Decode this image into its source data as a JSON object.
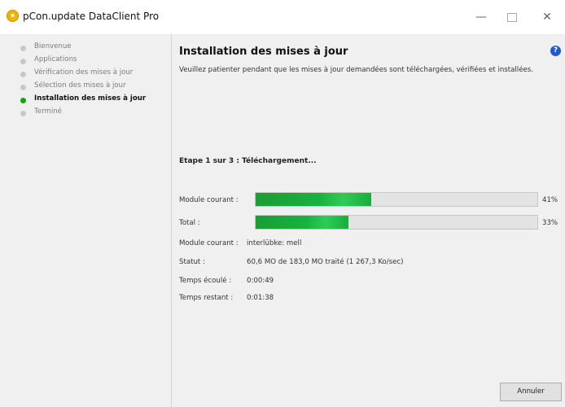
{
  "window": {
    "title": "pCon.update DataClient Pro",
    "minimize_label": "—",
    "close_label": "✕"
  },
  "sidebar": {
    "items": [
      {
        "label": "Bienvenue",
        "active": false
      },
      {
        "label": "Applications",
        "active": false
      },
      {
        "label": "Vérification des mises à jour",
        "active": false
      },
      {
        "label": "Sélection des mises à jour",
        "active": false
      },
      {
        "label": "Installation des mises à jour",
        "active": true
      },
      {
        "label": "Terminé",
        "active": false
      }
    ]
  },
  "main": {
    "title": "Installation des mises à jour",
    "help_label": "?",
    "subtitle": "Veuillez patienter pendant que les mises à jour demandées sont téléchargées, vérifiées et installées.",
    "step_heading": "Etape 1 sur 3 : Téléchargement...",
    "progress": {
      "current": {
        "label": "Module courant :",
        "percent": 41,
        "percent_label": "41%"
      },
      "total": {
        "label": "Total :",
        "percent": 33,
        "percent_label": "33%"
      }
    },
    "details": {
      "module": {
        "label": "Module courant :",
        "value": "interlübke: mell"
      },
      "status": {
        "label": "Statut :",
        "value": "60,6 MO de 183,0 MO traité (1 267,3 Ko/sec)"
      },
      "elapsed": {
        "label": "Temps écoulé :",
        "value": "0:00:49"
      },
      "remaining": {
        "label": "Temps restant :",
        "value": "0:01:38"
      }
    },
    "cancel_label": "Annuler"
  },
  "colors": {
    "accent_green": "#18b240",
    "help_blue": "#235ac8",
    "app_icon": "#f2b400"
  },
  "icons": {
    "app": "app-logo-icon",
    "help": "help-icon",
    "step": "step-dot-icon"
  }
}
